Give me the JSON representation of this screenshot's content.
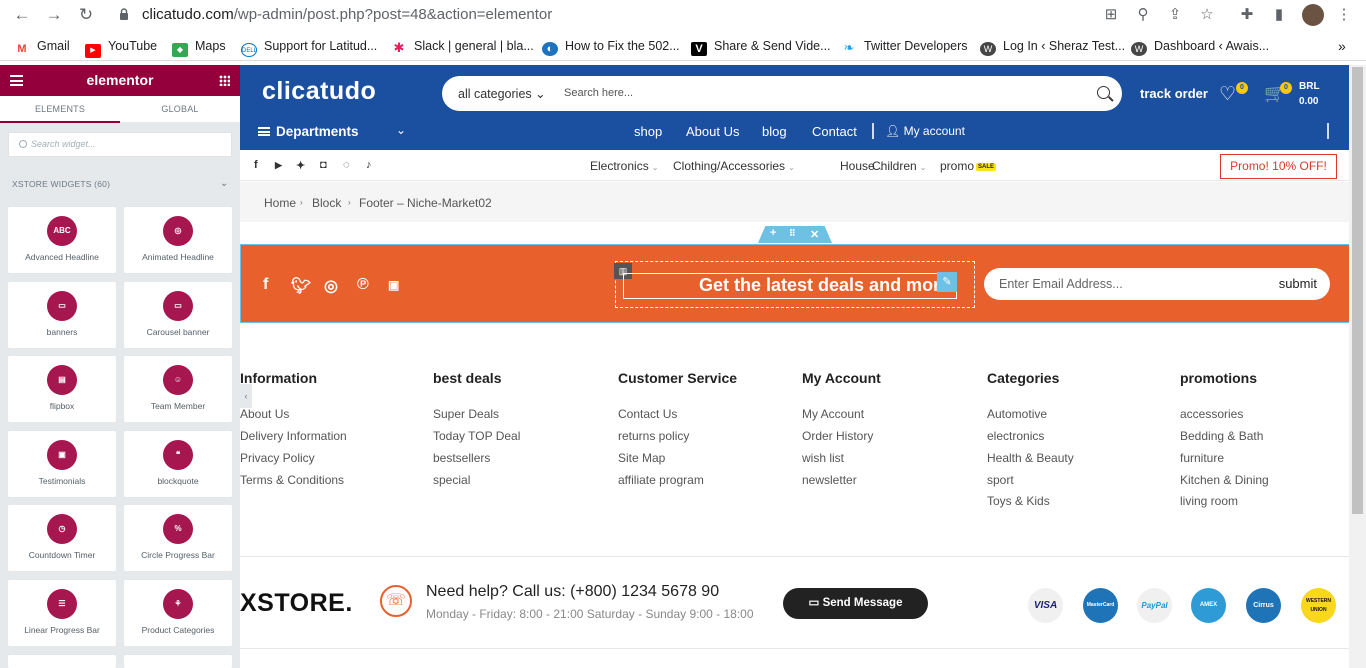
{
  "browser": {
    "url_host": "clicatudo.com",
    "url_path": "/wp-admin/post.php?post=48&action=elementor",
    "bookmarks": [
      {
        "label": "Gmail",
        "icon": "gmail-icon",
        "color": "#ea4335"
      },
      {
        "label": "YouTube",
        "icon": "youtube-icon",
        "color": "#ff0000"
      },
      {
        "label": "Maps",
        "icon": "maps-icon",
        "color": "#34a853"
      },
      {
        "label": "Support for Latitud...",
        "icon": "dell-icon",
        "color": "#0076ce"
      },
      {
        "label": "Slack | general | bla...",
        "icon": "slack-icon",
        "color": "#e01e5a"
      },
      {
        "label": "How to Fix the 502...",
        "icon": "site-icon",
        "color": "#1e73be"
      },
      {
        "label": "Share & Send Vide...",
        "icon": "v-icon",
        "color": "#000000"
      },
      {
        "label": "Twitter Developers",
        "icon": "twitter-icon",
        "color": "#1da1f2"
      },
      {
        "label": "Log In ‹ Sheraz Test...",
        "icon": "wordpress-icon",
        "color": "#464646"
      },
      {
        "label": "Dashboard ‹ Awais...",
        "icon": "wordpress-icon",
        "color": "#464646"
      }
    ]
  },
  "elementor": {
    "logo": "elementor",
    "tabs": [
      "ELEMENTS",
      "GLOBAL"
    ],
    "search_placeholder": "Search widget...",
    "category": "XSTORE WIDGETS (60)",
    "widgets": [
      {
        "label": "Advanced Headline",
        "glyph": "ABC"
      },
      {
        "label": "Animated Headline",
        "glyph": "◎"
      },
      {
        "label": "banners",
        "glyph": "▭"
      },
      {
        "label": "Carousel banner",
        "glyph": "▭"
      },
      {
        "label": "flipbox",
        "glyph": "▤"
      },
      {
        "label": "Team Member",
        "glyph": "☺"
      },
      {
        "label": "Testimonials",
        "glyph": "▣"
      },
      {
        "label": "blockquote",
        "glyph": "❝"
      },
      {
        "label": "Countdown Timer",
        "glyph": "◷"
      },
      {
        "label": "Circle Progress Bar",
        "glyph": "%"
      },
      {
        "label": "Linear Progress Bar",
        "glyph": "☰"
      },
      {
        "label": "Product Categories",
        "glyph": "⚘"
      }
    ]
  },
  "site": {
    "brand": "clicatudo",
    "search_category": "all categories",
    "search_placeholder": "Search here...",
    "track_order": "track order",
    "wishlist_count": "0",
    "cart_count": "0",
    "currency": "BRL",
    "cart_total": "0.00",
    "departments": "Departments",
    "menu": [
      "shop",
      "About Us",
      "blog",
      "Contact",
      "My account"
    ],
    "category_menu": [
      "Electronics",
      "Clothing/Accessories",
      "House",
      "Children",
      "promo"
    ],
    "sale_badge": "SALE",
    "promo_button": "Promo! 10% OFF!",
    "breadcrumb": [
      "Home",
      "Block",
      "Footer – Niche-Market02"
    ],
    "newsletter": {
      "heading": "Get the latest deals and more",
      "email_placeholder": "Enter Email Address...",
      "submit": "submit"
    },
    "footer_columns": [
      {
        "title": "Information",
        "links": [
          "About Us",
          "Delivery Information",
          "Privacy Policy",
          "Terms & Conditions"
        ]
      },
      {
        "title": "best deals",
        "links": [
          "Super Deals",
          "Today TOP Deal",
          "bestsellers",
          "special"
        ]
      },
      {
        "title": "Customer Service",
        "links": [
          "Contact Us",
          "returns policy",
          "Site Map",
          "affiliate program"
        ]
      },
      {
        "title": "My Account",
        "links": [
          "My Account",
          "Order History",
          "wish list",
          "newsletter"
        ]
      },
      {
        "title": "Categories",
        "links": [
          "Automotive",
          "electronics",
          "Health & Beauty",
          "sport",
          "Toys & Kids"
        ]
      },
      {
        "title": "promotions",
        "links": [
          "accessories",
          "Bedding & Bath",
          "furniture",
          "Kitchen & Dining",
          "living room"
        ]
      }
    ],
    "footer_logo": "XSTORE.",
    "help_text": "Need help? Call us: (+800) 1234 5678 90",
    "hours": "Monday - Friday: 8:00 - 21:00 Saturday - Sunday 9:00 - 18:00",
    "send_message": "Send Message",
    "payments": [
      {
        "label": "VISA",
        "color": "#1a1f71",
        "bg": "#f0f0f0"
      },
      {
        "label": "MasterCard",
        "color": "#ffffff",
        "bg": "#1f73b7"
      },
      {
        "label": "PayPal",
        "color": "#179bd7",
        "bg": "#f0f0f0"
      },
      {
        "label": "AMEX",
        "color": "#ffffff",
        "bg": "#2e9bd6"
      },
      {
        "label": "Cirrus",
        "color": "#ffffff",
        "bg": "#1f73b7"
      },
      {
        "label": "WESTERN UNION",
        "color": "#111111",
        "bg": "#f9d71c"
      }
    ]
  },
  "colors": {
    "header_blue": "#1b4fa0",
    "elementor_maroon": "#93003c",
    "newsletter_orange": "#e8602c"
  }
}
